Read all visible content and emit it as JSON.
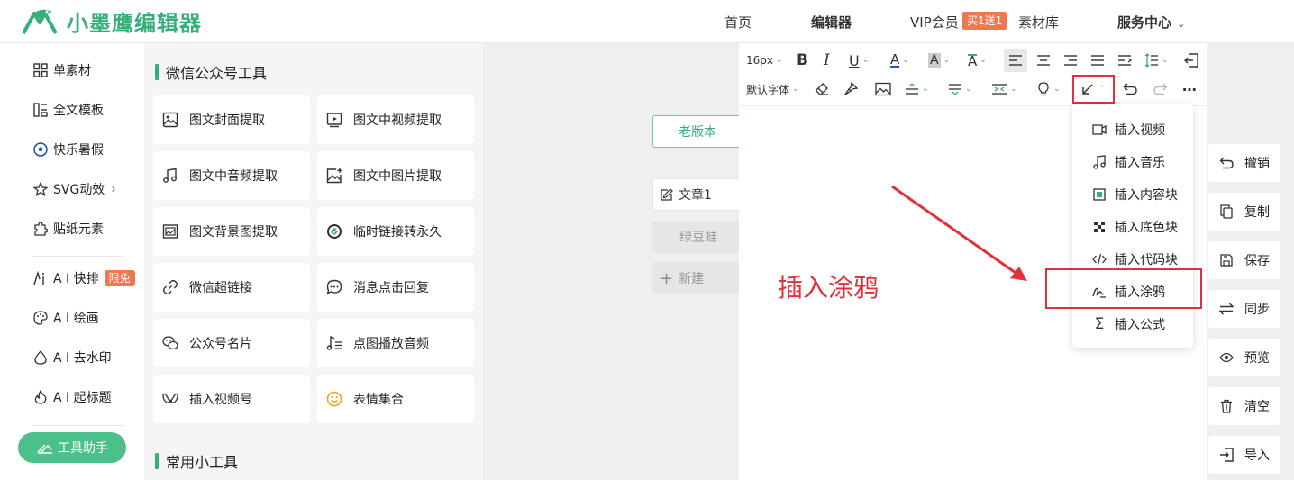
{
  "header": {
    "logo_text": "小墨鹰编辑器",
    "nav": {
      "home": "首页",
      "editor": "编辑器",
      "vip": "VIP会员",
      "vip_badge": "买1送1",
      "materials": "素材库",
      "service": "服务中心"
    }
  },
  "sidebar": {
    "items": [
      {
        "label": "单素材",
        "icon": "grid-icon"
      },
      {
        "label": "全文模板",
        "icon": "template-icon"
      },
      {
        "label": "快乐暑假",
        "icon": "soccer-ball-icon"
      },
      {
        "label": "SVG动效",
        "icon": "star-icon"
      },
      {
        "label": "贴纸元素",
        "icon": "puzzle-icon"
      },
      {
        "label": "A I 快排",
        "icon": "ai-icon",
        "badge": "限免"
      },
      {
        "label": "A I 绘画",
        "icon": "palette-icon"
      },
      {
        "label": "A I 去水印",
        "icon": "drop-icon"
      },
      {
        "label": "A I 起标题",
        "icon": "flame-icon"
      }
    ],
    "tool_helper": "工具助手"
  },
  "tools": {
    "section1_title": "微信公众号工具",
    "section2_title": "常用小工具",
    "cards": [
      {
        "label": "图文封面提取",
        "icon": "image-icon"
      },
      {
        "label": "图文中视频提取",
        "icon": "video-icon"
      },
      {
        "label": "图文中音频提取",
        "icon": "music-icon"
      },
      {
        "label": "图文中图片提取",
        "icon": "image-plus-icon"
      },
      {
        "label": "图文背景图提取",
        "icon": "background-image-icon"
      },
      {
        "label": "临时链接转永久",
        "icon": "link-circle-icon"
      },
      {
        "label": "微信超链接",
        "icon": "link-icon"
      },
      {
        "label": "消息点击回复",
        "icon": "chat-icon"
      },
      {
        "label": "公众号名片",
        "icon": "wechat-icon"
      },
      {
        "label": "点图播放音频",
        "icon": "music-list-icon"
      },
      {
        "label": "插入视频号",
        "icon": "channels-icon"
      },
      {
        "label": "表情集合",
        "icon": "emoji-icon"
      }
    ]
  },
  "articles": {
    "old_version": "老版本",
    "article1": "文章1",
    "article2": "绿豆蛙",
    "new": "新建"
  },
  "toolbar": {
    "font_size": "16px",
    "font_family": "默认字体"
  },
  "dropdown": {
    "items": [
      {
        "label": "插入视频",
        "icon": "video-camera-icon"
      },
      {
        "label": "插入音乐",
        "icon": "music-note-icon"
      },
      {
        "label": "插入内容块",
        "icon": "content-block-icon"
      },
      {
        "label": "插入底色块",
        "icon": "checker-icon"
      },
      {
        "label": "插入代码块",
        "icon": "code-icon"
      },
      {
        "label": "插入涂鸦",
        "icon": "scribble-icon"
      },
      {
        "label": "插入公式",
        "icon": "sigma-icon"
      }
    ]
  },
  "annotation": {
    "text": "插入涂鸦",
    "color": "#e0313b"
  },
  "actions": [
    {
      "label": "撤销",
      "icon": "undo-icon"
    },
    {
      "label": "复制",
      "icon": "copy-icon"
    },
    {
      "label": "保存",
      "icon": "save-icon"
    },
    {
      "label": "同步",
      "icon": "sync-icon"
    },
    {
      "label": "预览",
      "icon": "eye-icon"
    },
    {
      "label": "清空",
      "icon": "trash-icon"
    },
    {
      "label": "导入",
      "icon": "import-icon"
    }
  ],
  "colors": {
    "brand": "#35b07a",
    "badge": "#f07850"
  }
}
